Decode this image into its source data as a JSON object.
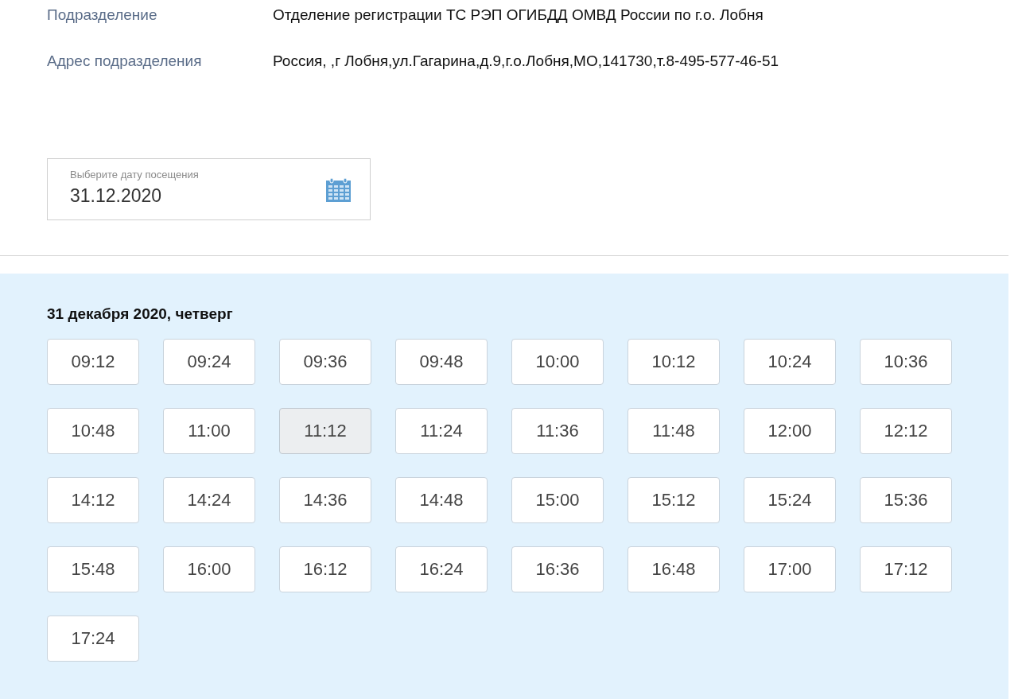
{
  "info": [
    {
      "label": "Подразделение",
      "value": "Отделение регистрации ТС РЭП ОГИБДД ОМВД России по г.о. Лобня"
    },
    {
      "label": "Адрес подразделения",
      "value": "Россия, ,г Лобня,ул.Гагарина,д.9,г.о.Лобня,МО,141730,т.8-495-577-46-51"
    }
  ],
  "date_field": {
    "label": "Выберите дату посещения",
    "value": "31.12.2020"
  },
  "slots": {
    "heading": "31 декабря 2020, четверг",
    "times": [
      {
        "time": "09:12",
        "highlighted": false
      },
      {
        "time": "09:24",
        "highlighted": false
      },
      {
        "time": "09:36",
        "highlighted": false
      },
      {
        "time": "09:48",
        "highlighted": false
      },
      {
        "time": "10:00",
        "highlighted": false
      },
      {
        "time": "10:12",
        "highlighted": false
      },
      {
        "time": "10:24",
        "highlighted": false
      },
      {
        "time": "10:36",
        "highlighted": false
      },
      {
        "time": "10:48",
        "highlighted": false
      },
      {
        "time": "11:00",
        "highlighted": false
      },
      {
        "time": "11:12",
        "highlighted": true
      },
      {
        "time": "11:24",
        "highlighted": false
      },
      {
        "time": "11:36",
        "highlighted": false
      },
      {
        "time": "11:48",
        "highlighted": false
      },
      {
        "time": "12:00",
        "highlighted": false
      },
      {
        "time": "12:12",
        "highlighted": false
      },
      {
        "time": "14:12",
        "highlighted": false
      },
      {
        "time": "14:24",
        "highlighted": false
      },
      {
        "time": "14:36",
        "highlighted": false
      },
      {
        "time": "14:48",
        "highlighted": false
      },
      {
        "time": "15:00",
        "highlighted": false
      },
      {
        "time": "15:12",
        "highlighted": false
      },
      {
        "time": "15:24",
        "highlighted": false
      },
      {
        "time": "15:36",
        "highlighted": false
      },
      {
        "time": "15:48",
        "highlighted": false
      },
      {
        "time": "16:00",
        "highlighted": false
      },
      {
        "time": "16:12",
        "highlighted": false
      },
      {
        "time": "16:24",
        "highlighted": false
      },
      {
        "time": "16:36",
        "highlighted": false
      },
      {
        "time": "16:48",
        "highlighted": false
      },
      {
        "time": "17:00",
        "highlighted": false
      },
      {
        "time": "17:12",
        "highlighted": false
      },
      {
        "time": "17:24",
        "highlighted": false
      }
    ]
  }
}
